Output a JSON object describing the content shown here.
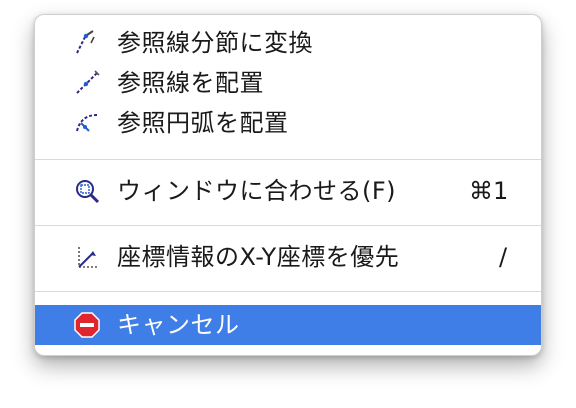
{
  "menu": {
    "items": [
      {
        "label": "参照線分節に変換",
        "shortcut": "",
        "icon": "convert-reference-line-icon"
      },
      {
        "label": "参照線を配置",
        "shortcut": "",
        "icon": "place-reference-line-icon"
      },
      {
        "label": "参照円弧を配置",
        "shortcut": "",
        "icon": "place-reference-arc-icon"
      },
      {
        "label": "ウィンドウに合わせる(F)",
        "shortcut": "⌘1",
        "icon": "zoom-fit-icon"
      },
      {
        "label": "座標情報のX-Y座標を優先",
        "shortcut": "/",
        "icon": "xy-coordinates-icon"
      },
      {
        "label": "キャンセル",
        "shortcut": "",
        "icon": "cancel-icon"
      }
    ],
    "colors": {
      "selection": "#3f7ee6",
      "cancel_icon": "#e0252e"
    }
  }
}
